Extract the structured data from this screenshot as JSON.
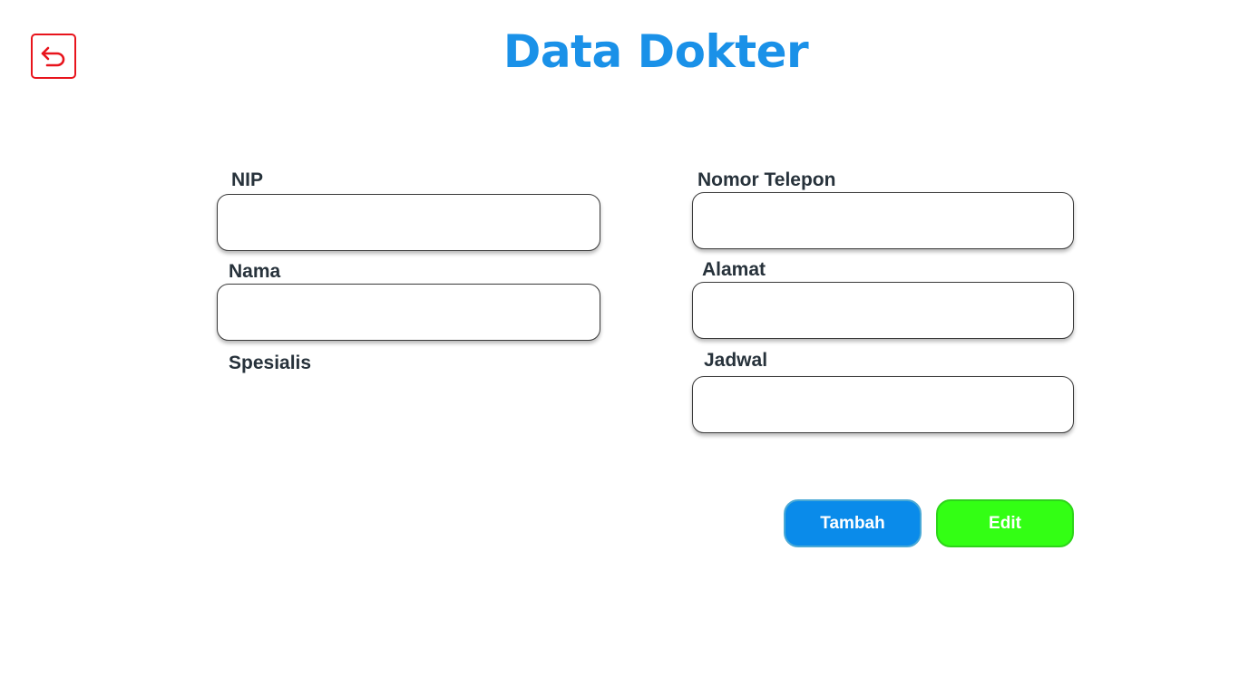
{
  "header": {
    "title": "Data Dokter",
    "back_icon": "back-arrow-icon",
    "back_color": "#e8141c",
    "title_color": "#1a91e8"
  },
  "form": {
    "nip": {
      "label": "NIP",
      "value": "",
      "placeholder": ""
    },
    "nama": {
      "label": "Nama",
      "value": "",
      "placeholder": ""
    },
    "spesialis": {
      "label": "Spesialis",
      "value": ""
    },
    "nomor_telepon": {
      "label": "Nomor Telepon",
      "value": "",
      "placeholder": ""
    },
    "alamat": {
      "label": "Alamat",
      "value": "",
      "placeholder": ""
    },
    "jadwal": {
      "label": "Jadwal",
      "value": "",
      "placeholder": ""
    }
  },
  "actions": {
    "add_label": "Tambah",
    "edit_label": "Edit",
    "add_color": "#0a8bea",
    "edit_color": "#33ff14"
  }
}
